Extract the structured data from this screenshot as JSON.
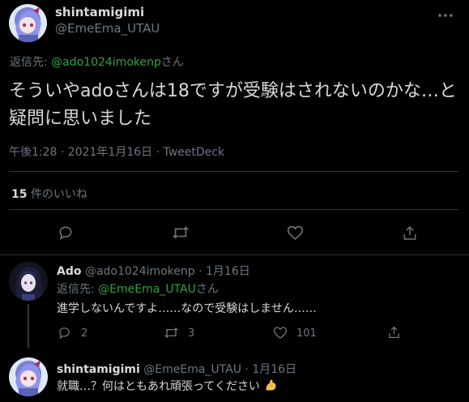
{
  "main": {
    "user": {
      "name": "shintamigimi",
      "handle": "@EmeEma_UTAU"
    },
    "more_icon": "more-horizontal-icon",
    "reply_label": "返信先:",
    "reply_to": "@ado1024imokenp",
    "reply_suffix": "さん",
    "text_line1": "そういやadoさんは18ですが受験はされないのかな…と",
    "text_line2": "疑問に思いました",
    "meta": "午後1:28 · 2021年1月16日 · TweetDeck",
    "likes_count": "15",
    "likes_label": "件のいいね",
    "actions": [
      "reply-icon",
      "retweet-icon",
      "like-icon",
      "share-icon"
    ]
  },
  "reply1": {
    "name": "Ado",
    "handle": "@ado1024imokenp",
    "date": "· 1月16日",
    "reply_label": "返信先:",
    "reply_to": "@EmeEma_UTAU",
    "reply_suffix": "さん",
    "text": "進学しないんですよ……なので受験はしません……",
    "reply_count": "2",
    "retweet_count": "3",
    "like_count": "101"
  },
  "reply2": {
    "name": "shintamigimi",
    "handle": "@EmeEma_UTAU",
    "date": "· 1月16日",
    "text": "就職…？何はともあれ頑張ってください",
    "emoji": "flexed-biceps-icon"
  },
  "colors": {
    "background": "#000000",
    "text": "#d9d9d9",
    "muted": "#6e767d",
    "mention": "#2aa640",
    "divider": "#2f3336"
  }
}
